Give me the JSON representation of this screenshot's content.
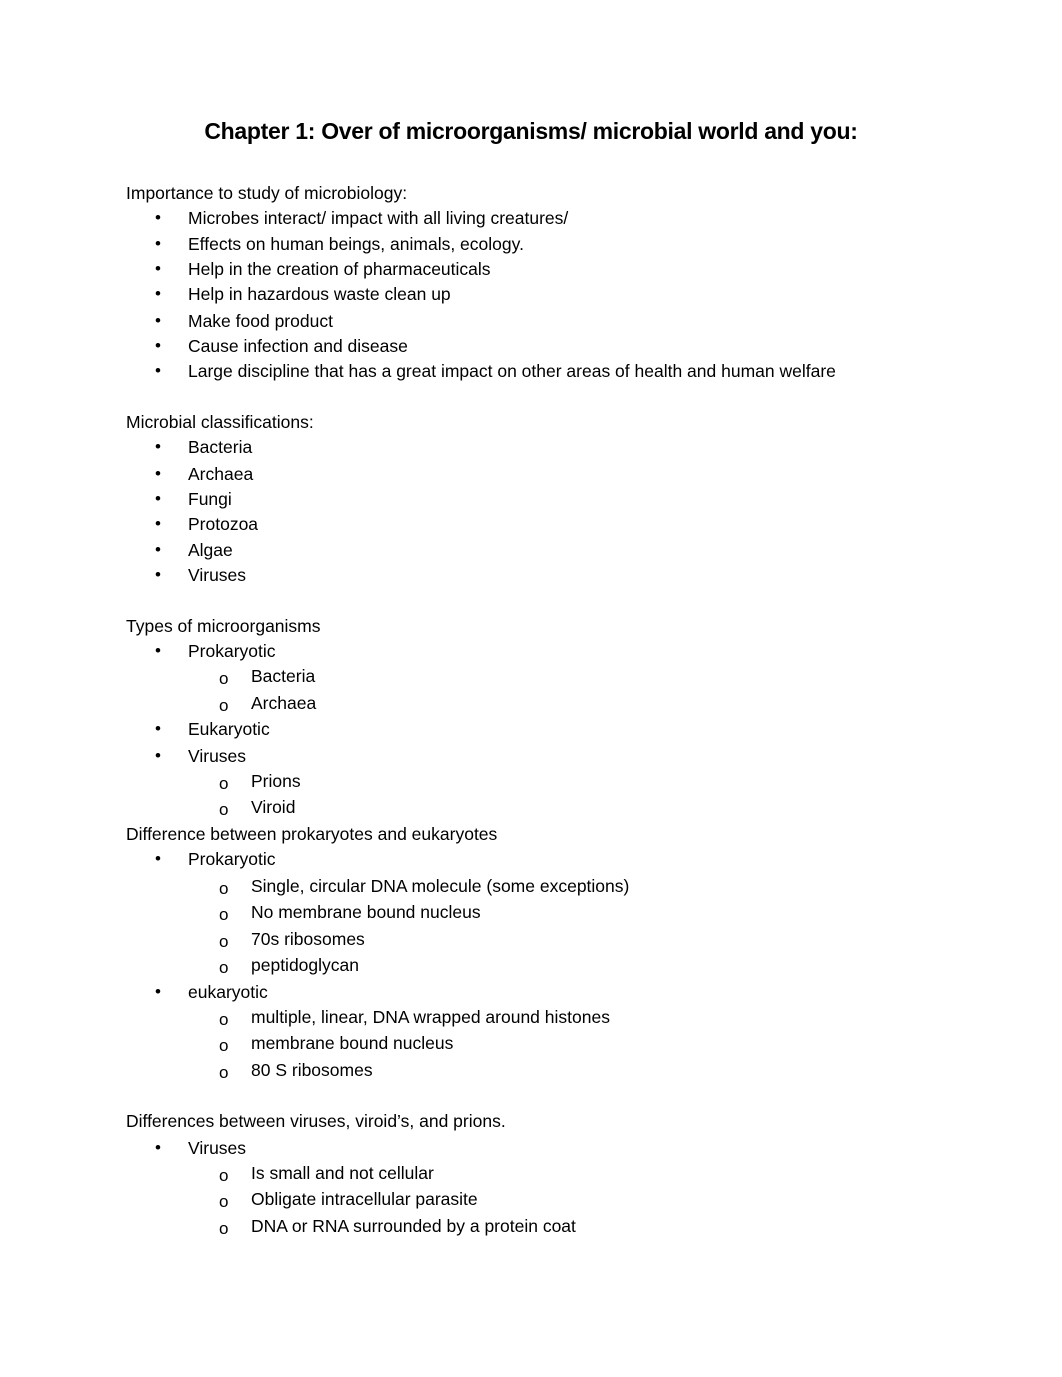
{
  "document": {
    "title": "Chapter 1: Over of microorganisms/ microbial world and you:",
    "sections": [
      {
        "heading": "Importance to study of microbiology:",
        "items": [
          {
            "text": "Microbes interact/ impact with all living creatures/",
            "children": []
          },
          {
            "text": "Effects on human beings, animals, ecology.",
            "children": []
          },
          {
            "text": "Help in the creation of pharmaceuticals",
            "children": []
          },
          {
            "text": "Help in hazardous waste clean up",
            "children": []
          },
          {
            "text": "Make food product",
            "children": []
          },
          {
            "text": "Cause infection and disease",
            "children": []
          },
          {
            "text": "Large discipline that has a great impact on other areas of health and human welfare",
            "children": []
          }
        ]
      },
      {
        "heading": "Microbial classifications:",
        "items": [
          {
            "text": "Bacteria",
            "children": []
          },
          {
            "text": "Archaea",
            "children": []
          },
          {
            "text": "Fungi",
            "children": []
          },
          {
            "text": "Protozoa",
            "children": []
          },
          {
            "text": "Algae",
            "children": []
          },
          {
            "text": "Viruses",
            "children": []
          }
        ]
      },
      {
        "heading": "Types of microorganisms",
        "items": [
          {
            "text": "Prokaryotic",
            "children": [
              "Bacteria",
              "Archaea"
            ]
          },
          {
            "text": "Eukaryotic",
            "children": []
          },
          {
            "text": "Viruses",
            "children": [
              "Prions",
              "Viroid"
            ]
          }
        ]
      },
      {
        "heading": "Difference between prokaryotes and eukaryotes",
        "items": [
          {
            "text": "Prokaryotic",
            "children": [
              "Single, circular DNA molecule (some exceptions)",
              "No membrane bound nucleus",
              "70s ribosomes",
              "peptidoglycan"
            ]
          },
          {
            "text": "eukaryotic",
            "children": [
              "multiple, linear, DNA wrapped around histones",
              "membrane bound nucleus",
              "80 S ribosomes"
            ]
          }
        ]
      },
      {
        "heading": "Differences between viruses, viroid’s, and prions.",
        "items": [
          {
            "text": "Viruses",
            "children": [
              "Is small and not cellular",
              "Obligate intracellular parasite",
              "DNA or RNA surrounded by a protein coat"
            ]
          }
        ]
      }
    ],
    "bullet_glyph": "•",
    "sub_bullet_glyph": "o"
  }
}
